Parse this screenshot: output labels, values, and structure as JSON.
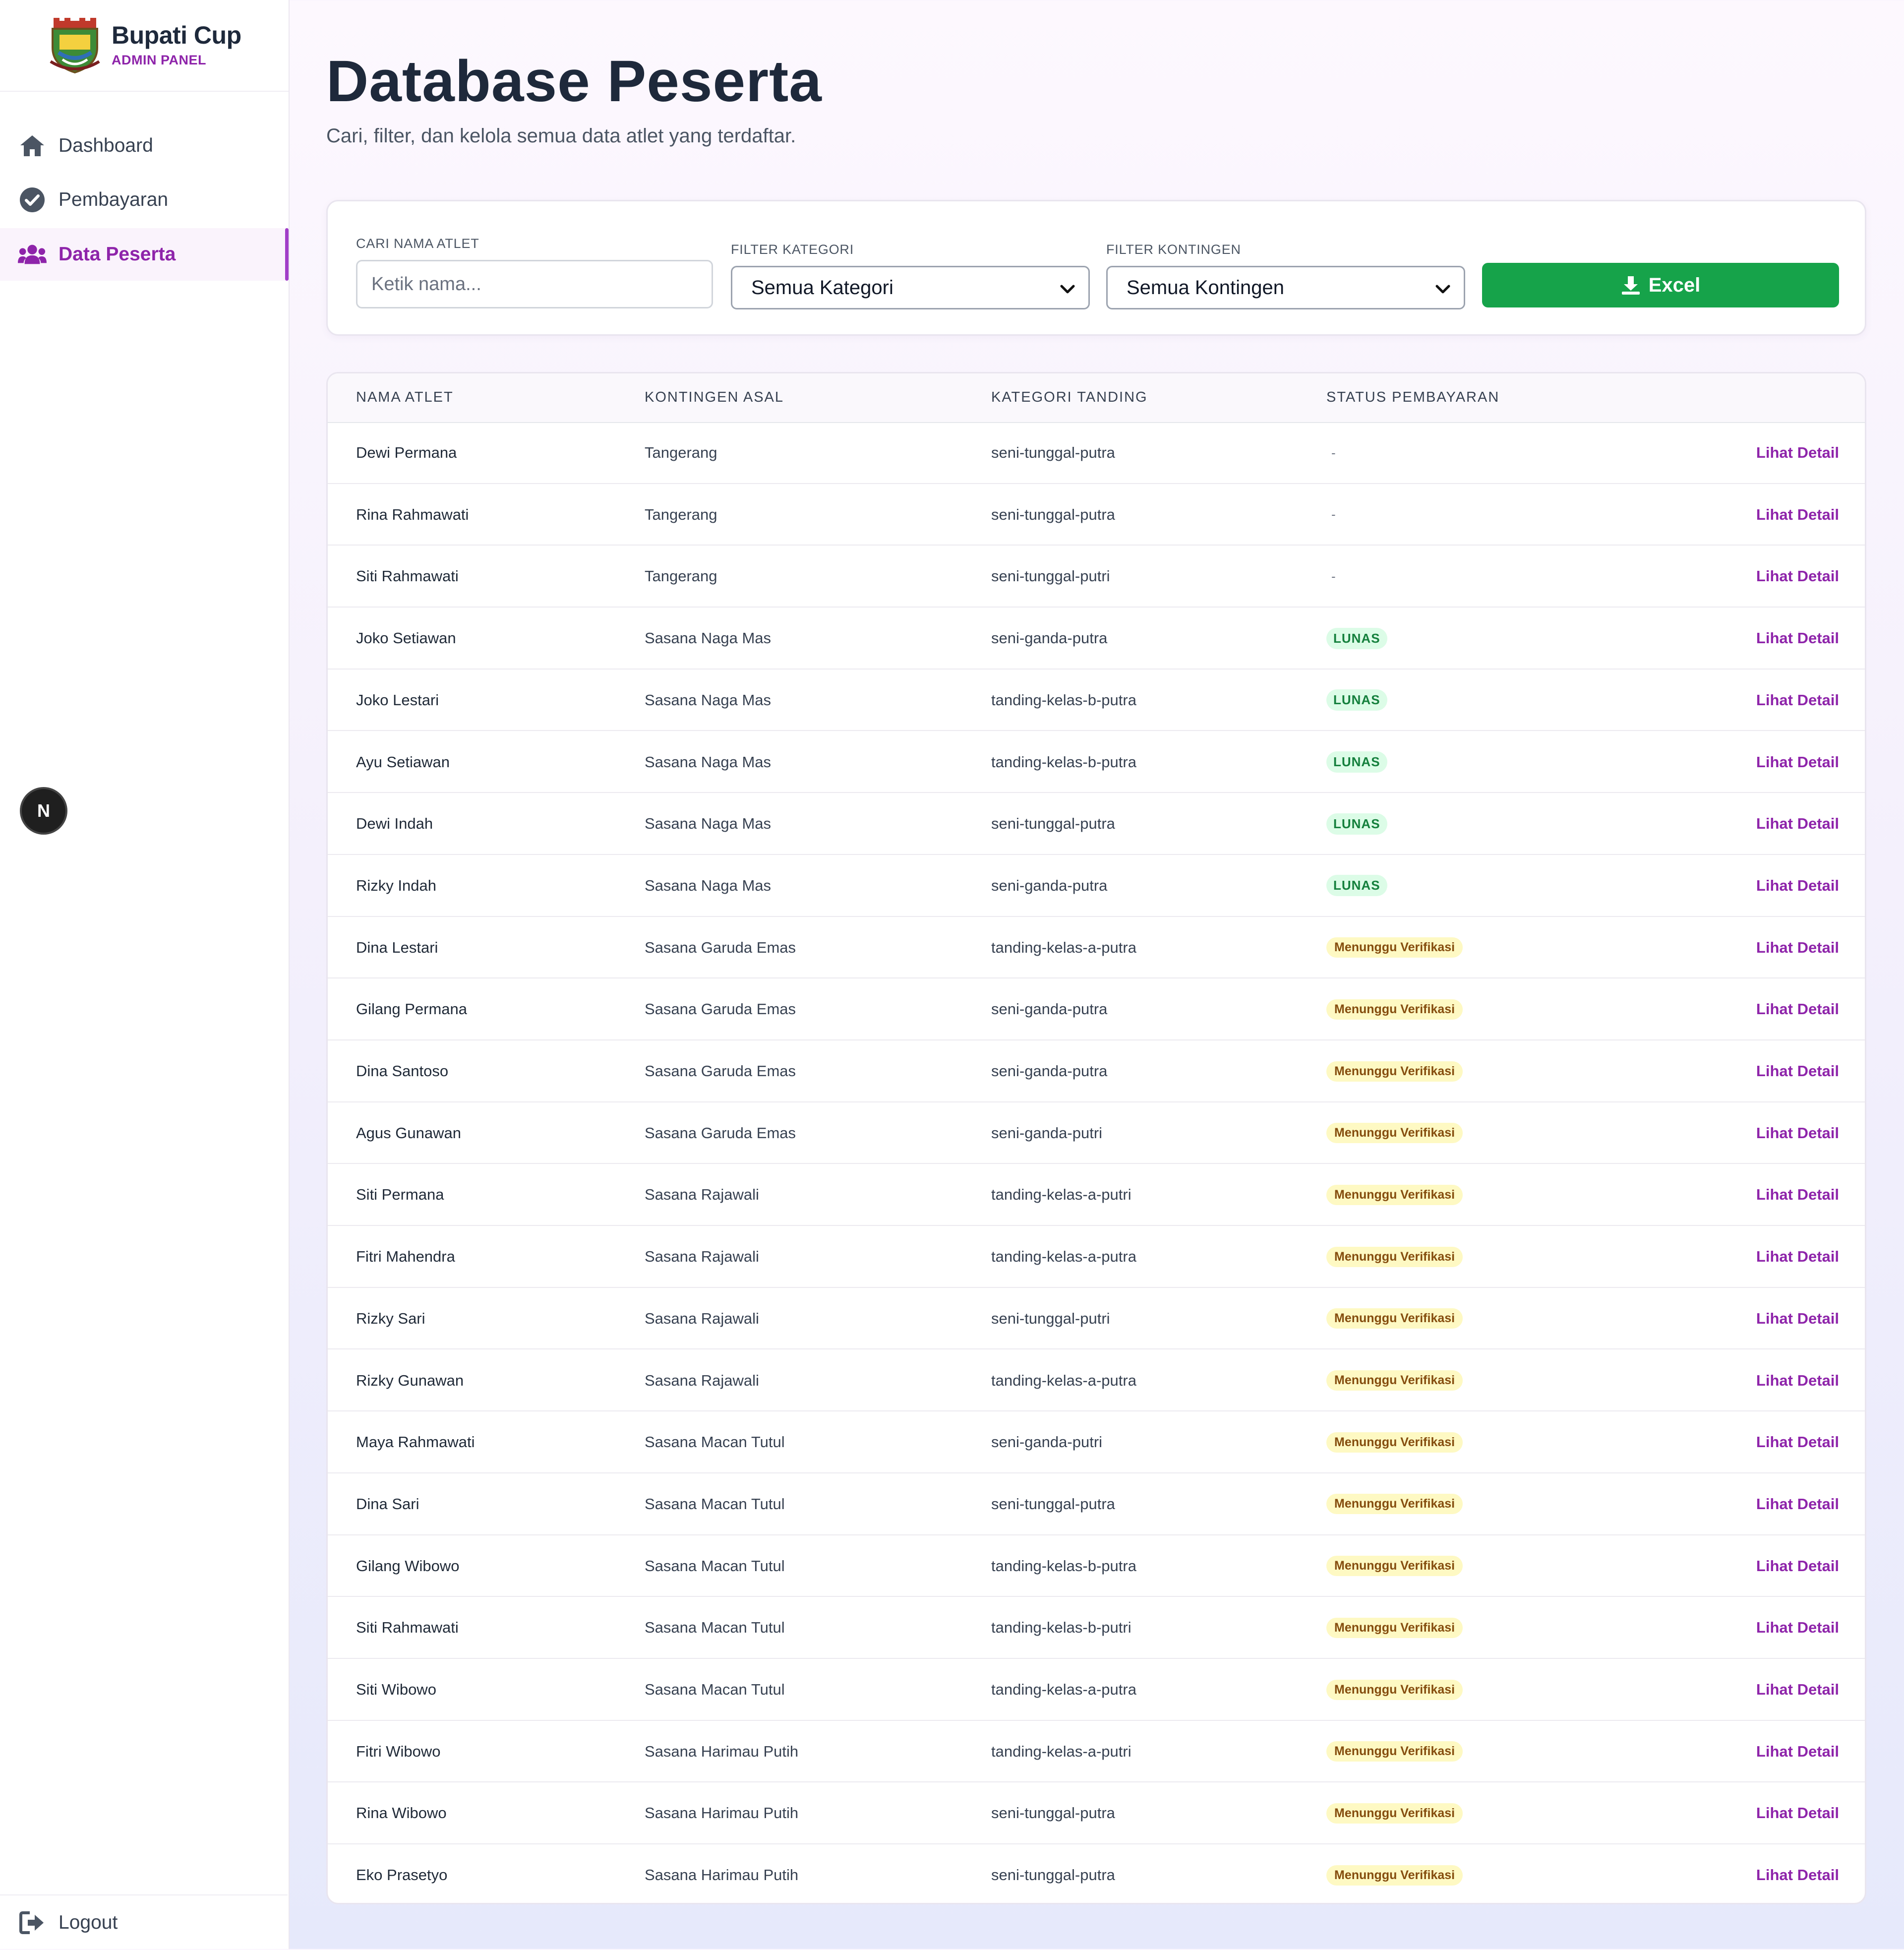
{
  "brand": {
    "title": "Bupati Cup",
    "subtitle": "ADMIN PANEL"
  },
  "sidebar": {
    "items": [
      {
        "label": "Dashboard",
        "icon": "home-icon"
      },
      {
        "label": "Pembayaran",
        "icon": "check-circle-icon"
      },
      {
        "label": "Data Peserta",
        "icon": "users-icon",
        "active": true
      }
    ],
    "logout_label": "Logout",
    "badge_letter": "N"
  },
  "header": {
    "title": "Database Peserta",
    "subtitle": "Cari, filter, dan kelola semua data atlet yang terdaftar."
  },
  "filters": {
    "search_label": "CARI NAMA ATLET",
    "search_placeholder": "Ketik nama...",
    "search_value": "",
    "category_label": "FILTER KATEGORI",
    "category_value": "Semua Kategori",
    "contingent_label": "FILTER KONTINGEN",
    "contingent_value": "Semua Kontingen",
    "excel_label": "Excel"
  },
  "colors": {
    "accent": "#8e24aa",
    "excel": "#16a34a",
    "lunas_bg": "#dcfce7",
    "wait_bg": "#fef9c3"
  },
  "table": {
    "headers": [
      "NAMA ATLET",
      "KONTINGEN ASAL",
      "KATEGORI TANDING",
      "STATUS PEMBAYARAN"
    ],
    "action_label": "Lihat Detail",
    "rows": [
      {
        "name": "Dewi Permana",
        "kontingen": "Tangerang",
        "kategori": "seni-tunggal-putra",
        "status": "-"
      },
      {
        "name": "Rina Rahmawati",
        "kontingen": "Tangerang",
        "kategori": "seni-tunggal-putra",
        "status": "-"
      },
      {
        "name": "Siti Rahmawati",
        "kontingen": "Tangerang",
        "kategori": "seni-tunggal-putri",
        "status": "-"
      },
      {
        "name": "Joko Setiawan",
        "kontingen": "Sasana Naga Mas",
        "kategori": "seni-ganda-putra",
        "status": "LUNAS"
      },
      {
        "name": "Joko Lestari",
        "kontingen": "Sasana Naga Mas",
        "kategori": "tanding-kelas-b-putra",
        "status": "LUNAS"
      },
      {
        "name": "Ayu Setiawan",
        "kontingen": "Sasana Naga Mas",
        "kategori": "tanding-kelas-b-putra",
        "status": "LUNAS"
      },
      {
        "name": "Dewi Indah",
        "kontingen": "Sasana Naga Mas",
        "kategori": "seni-tunggal-putra",
        "status": "LUNAS"
      },
      {
        "name": "Rizky Indah",
        "kontingen": "Sasana Naga Mas",
        "kategori": "seni-ganda-putra",
        "status": "LUNAS"
      },
      {
        "name": "Dina Lestari",
        "kontingen": "Sasana Garuda Emas",
        "kategori": "tanding-kelas-a-putra",
        "status": "Menunggu Verifikasi"
      },
      {
        "name": "Gilang Permana",
        "kontingen": "Sasana Garuda Emas",
        "kategori": "seni-ganda-putra",
        "status": "Menunggu Verifikasi"
      },
      {
        "name": "Dina Santoso",
        "kontingen": "Sasana Garuda Emas",
        "kategori": "seni-ganda-putra",
        "status": "Menunggu Verifikasi"
      },
      {
        "name": "Agus Gunawan",
        "kontingen": "Sasana Garuda Emas",
        "kategori": "seni-ganda-putri",
        "status": "Menunggu Verifikasi"
      },
      {
        "name": "Siti Permana",
        "kontingen": "Sasana Rajawali",
        "kategori": "tanding-kelas-a-putri",
        "status": "Menunggu Verifikasi"
      },
      {
        "name": "Fitri Mahendra",
        "kontingen": "Sasana Rajawali",
        "kategori": "tanding-kelas-a-putra",
        "status": "Menunggu Verifikasi"
      },
      {
        "name": "Rizky Sari",
        "kontingen": "Sasana Rajawali",
        "kategori": "seni-tunggal-putri",
        "status": "Menunggu Verifikasi"
      },
      {
        "name": "Rizky Gunawan",
        "kontingen": "Sasana Rajawali",
        "kategori": "tanding-kelas-a-putra",
        "status": "Menunggu Verifikasi"
      },
      {
        "name": "Maya Rahmawati",
        "kontingen": "Sasana Macan Tutul",
        "kategori": "seni-ganda-putri",
        "status": "Menunggu Verifikasi"
      },
      {
        "name": "Dina Sari",
        "kontingen": "Sasana Macan Tutul",
        "kategori": "seni-tunggal-putra",
        "status": "Menunggu Verifikasi"
      },
      {
        "name": "Gilang Wibowo",
        "kontingen": "Sasana Macan Tutul",
        "kategori": "tanding-kelas-b-putra",
        "status": "Menunggu Verifikasi"
      },
      {
        "name": "Siti Rahmawati",
        "kontingen": "Sasana Macan Tutul",
        "kategori": "tanding-kelas-b-putri",
        "status": "Menunggu Verifikasi"
      },
      {
        "name": "Siti Wibowo",
        "kontingen": "Sasana Macan Tutul",
        "kategori": "tanding-kelas-a-putra",
        "status": "Menunggu Verifikasi"
      },
      {
        "name": "Fitri Wibowo",
        "kontingen": "Sasana Harimau Putih",
        "kategori": "tanding-kelas-a-putri",
        "status": "Menunggu Verifikasi"
      },
      {
        "name": "Rina Wibowo",
        "kontingen": "Sasana Harimau Putih",
        "kategori": "seni-tunggal-putra",
        "status": "Menunggu Verifikasi"
      },
      {
        "name": "Eko Prasetyo",
        "kontingen": "Sasana Harimau Putih",
        "kategori": "seni-tunggal-putra",
        "status": "Menunggu Verifikasi"
      }
    ]
  }
}
